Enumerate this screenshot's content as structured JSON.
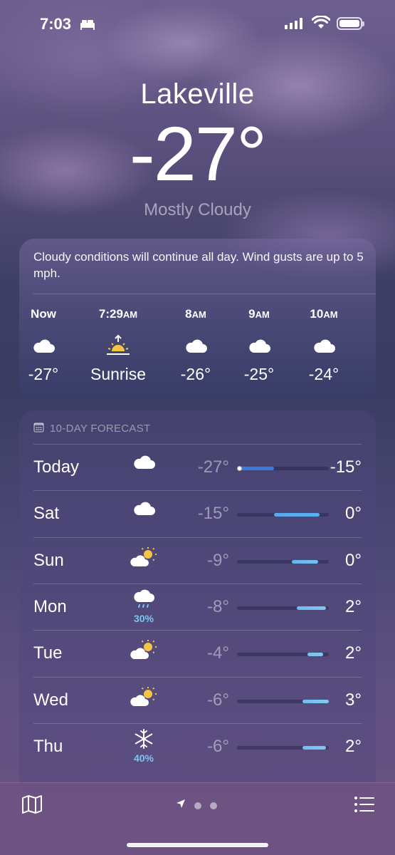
{
  "status": {
    "time": "7:03"
  },
  "location": {
    "city": "Lakeville",
    "temperature": "-27°",
    "condition": "Mostly Cloudy"
  },
  "hourly": {
    "summary": "Cloudy conditions will continue all day. Wind gusts are up to 5 mph.",
    "items": [
      {
        "time": "Now",
        "suffix": "",
        "icon": "cloud-icon",
        "value": "-27°"
      },
      {
        "time": "7:29",
        "suffix": "AM",
        "icon": "sunrise-icon",
        "value": "Sunrise"
      },
      {
        "time": "8",
        "suffix": "AM",
        "icon": "cloud-icon",
        "value": "-26°"
      },
      {
        "time": "9",
        "suffix": "AM",
        "icon": "cloud-icon",
        "value": "-25°"
      },
      {
        "time": "10",
        "suffix": "AM",
        "icon": "cloud-icon",
        "value": "-24°"
      }
    ]
  },
  "forecast": {
    "title": "10-DAY FORECAST",
    "days": [
      {
        "day": "Today",
        "icon": "cloud-icon",
        "precip": "",
        "low": "-27°",
        "high": "-15°",
        "range_start": 0.0,
        "range_end": 0.4,
        "current_marker": 0.0,
        "colors": [
          "#3a7be0",
          "#3a7be0"
        ]
      },
      {
        "day": "Sat",
        "icon": "cloud-icon",
        "precip": "",
        "low": "-15°",
        "high": "0°",
        "range_start": 0.4,
        "range_end": 0.9,
        "colors": [
          "#5aa8ee",
          "#5ab0f0"
        ]
      },
      {
        "day": "Sun",
        "icon": "partly-sunny-icon",
        "precip": "",
        "low": "-9°",
        "high": "0°",
        "range_start": 0.6,
        "range_end": 0.88,
        "colors": [
          "#6ab4ee",
          "#72c2f2"
        ]
      },
      {
        "day": "Mon",
        "icon": "rain-cloud-icon",
        "precip": "30%",
        "low": "-8°",
        "high": "2°",
        "range_start": 0.65,
        "range_end": 0.97,
        "colors": [
          "#6fbaef",
          "#7cc8f2"
        ]
      },
      {
        "day": "Tue",
        "icon": "partly-sunny-icon",
        "precip": "",
        "low": "-4°",
        "high": "2°",
        "range_start": 0.77,
        "range_end": 0.94,
        "colors": [
          "#7ac2f0",
          "#80c8f2"
        ]
      },
      {
        "day": "Wed",
        "icon": "partly-sunny-icon",
        "precip": "",
        "low": "-6°",
        "high": "3°",
        "range_start": 0.71,
        "range_end": 1.0,
        "colors": [
          "#72bff0",
          "#80cbf3"
        ]
      },
      {
        "day": "Thu",
        "icon": "snowflake-icon",
        "precip": "40%",
        "low": "-6°",
        "high": "2°",
        "range_start": 0.71,
        "range_end": 0.97,
        "colors": [
          "#72bff0",
          "#7ec7f2"
        ]
      }
    ]
  }
}
